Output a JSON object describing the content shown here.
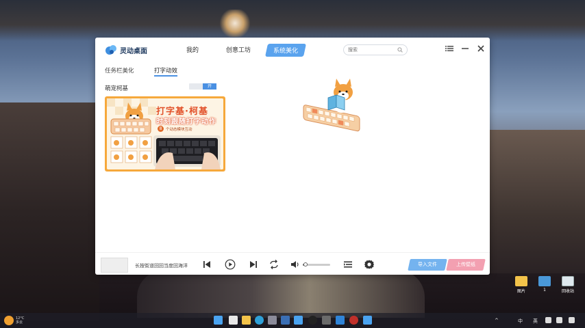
{
  "app": {
    "name": "灵动桌面",
    "nav_tabs": [
      {
        "label": "我的",
        "active": false
      },
      {
        "label": "创意工坊",
        "active": false
      },
      {
        "label": "系统美化",
        "active": true
      }
    ],
    "search": {
      "placeholder": "搜索"
    },
    "window_controls": [
      "menu-icon",
      "minimize-icon",
      "close-icon"
    ]
  },
  "subtabs": [
    {
      "label": "任务栏美化",
      "active": false
    },
    {
      "label": "打字动效",
      "active": true
    }
  ],
  "section": {
    "label": "萌宠柯基",
    "toggle_label": "开",
    "toggle_on": true
  },
  "card": {
    "title": "打字基·柯基",
    "subtitle": "时刻跟随打字动作",
    "badge": "8",
    "note": "个动态模块互动"
  },
  "bottom": {
    "hint": "长按街道回回当度回海洋",
    "volume_level": 0.1,
    "import_label": "导入文件",
    "upload_label": "上传壁纸"
  },
  "desktop_icons": [
    {
      "label": "图片",
      "icon": "folder-icon"
    },
    {
      "label": "1",
      "icon": "folder-icon"
    },
    {
      "label": "回收站",
      "icon": "recycle-bin-icon"
    }
  ],
  "taskbar": {
    "weather_line1": "12°C",
    "weather_line2": "多云",
    "tray_lang": "中",
    "tray_extra": "英"
  },
  "colors": {
    "accent": "#5aa3ee",
    "import": "#74b3ef",
    "upload": "#f3a0b1",
    "card_frame": "#f6a83b"
  }
}
